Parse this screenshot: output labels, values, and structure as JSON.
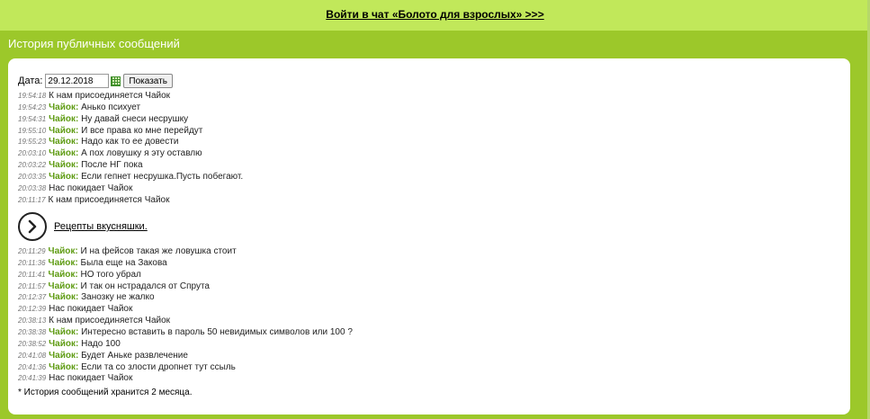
{
  "banner": {
    "link_text": "Войти в чат «Болото для взрослых» >>>"
  },
  "section": {
    "title": "История публичных сообщений"
  },
  "filter": {
    "date_label": "Дата:",
    "date_value": "29.12.2018",
    "show_label": "Показать"
  },
  "messages_a": [
    {
      "time": "19:54:18",
      "nick": "",
      "text": "К нам присоединяется Чайок"
    },
    {
      "time": "19:54:23",
      "nick": "Чайок:",
      "text": " Анько психует"
    },
    {
      "time": "19:54:31",
      "nick": "Чайок:",
      "text": " Ну давай снеси несрушку"
    },
    {
      "time": "19:55:10",
      "nick": "Чайок:",
      "text": " И все права ко мне перейдут"
    },
    {
      "time": "19:55:23",
      "nick": "Чайок:",
      "text": " Надо как то ее довести"
    },
    {
      "time": "20:03:10",
      "nick": "Чайок:",
      "text": " А пох ловушку я эту оставлю"
    },
    {
      "time": "20:03:22",
      "nick": "Чайок:",
      "text": " После НГ пока"
    },
    {
      "time": "20:03:35",
      "nick": "Чайок:",
      "text": " Если гепнет несрушка.Пусть побегают."
    },
    {
      "time": "20:03:38",
      "nick": "",
      "text": "Нас покидает Чайок"
    },
    {
      "time": "20:11:17",
      "nick": "",
      "text": "К нам присоединяется Чайок"
    }
  ],
  "promo": {
    "link_text": "Рецепты вкусняшки."
  },
  "messages_b": [
    {
      "time": "20:11:29",
      "nick": "Чайок:",
      "text": " И на фейсов такая же ловушка стоит"
    },
    {
      "time": "20:11:36",
      "nick": "Чайок:",
      "text": " Была еще на Закова"
    },
    {
      "time": "20:11:41",
      "nick": "Чайок:",
      "text": " НО того убрал"
    },
    {
      "time": "20:11:57",
      "nick": "Чайок:",
      "text": " И так он нстрадался от Спрута"
    },
    {
      "time": "20:12:37",
      "nick": "Чайок:",
      "text": " Занозку не жалко"
    },
    {
      "time": "20:12:39",
      "nick": "",
      "text": "Нас покидает Чайок"
    },
    {
      "time": "20:38:13",
      "nick": "",
      "text": "К нам присоединяется Чайок"
    },
    {
      "time": "20:38:38",
      "nick": "Чайок:",
      "text": " Интересно вставить в пароль 50 невидимых символов или 100 ?"
    },
    {
      "time": "20:38:52",
      "nick": "Чайок:",
      "text": " Надо 100"
    },
    {
      "time": "20:41:08",
      "nick": "Чайок:",
      "text": " Будет Аньке развлечение"
    },
    {
      "time": "20:41:36",
      "nick": "Чайок:",
      "text": " Если та со злости дропнет тут ссыль"
    },
    {
      "time": "20:41:39",
      "nick": "",
      "text": "Нас покидает Чайок"
    }
  ],
  "footnote": "* История сообщений хранится 2 месяца."
}
